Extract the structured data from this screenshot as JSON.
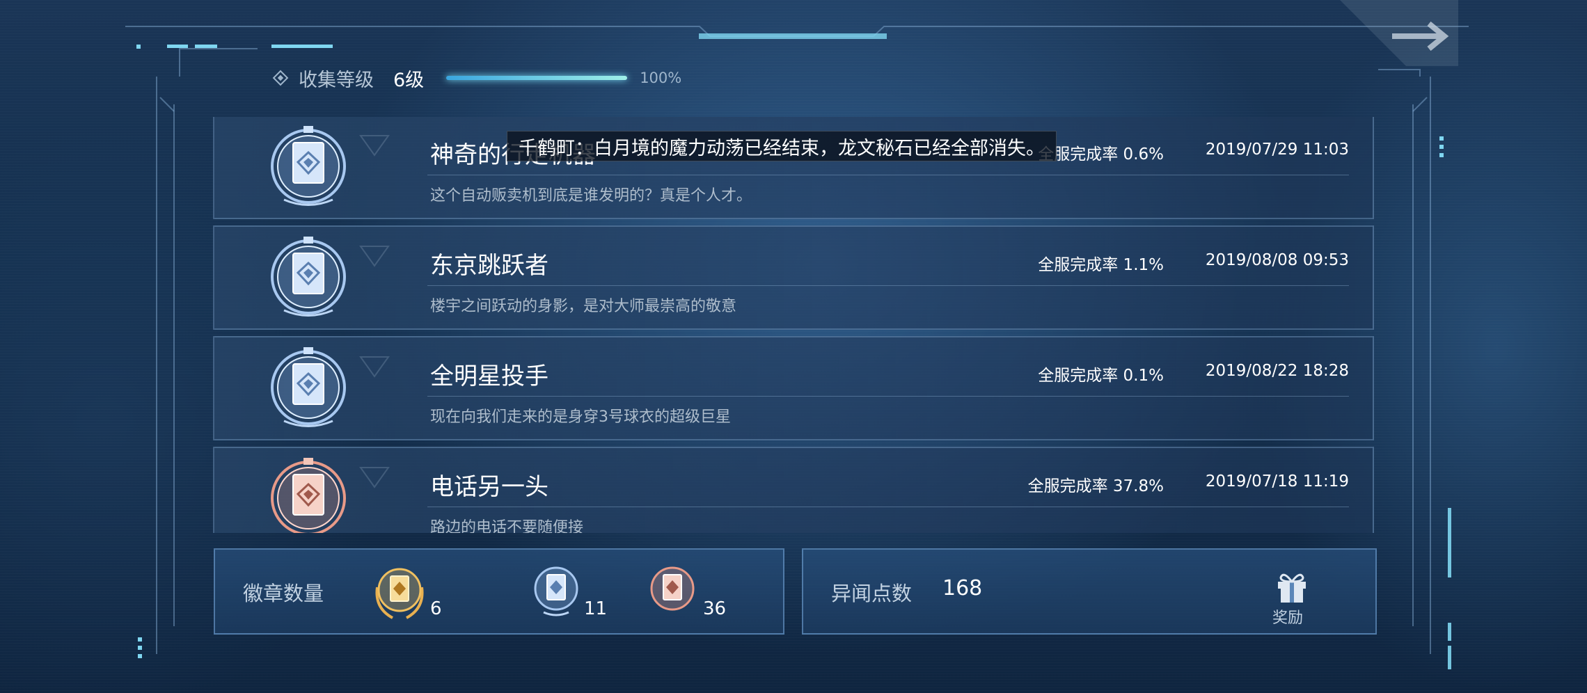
{
  "header": {
    "level_label": "收集等级",
    "level_value": "6级",
    "progress_percent": 100,
    "progress_text": "100%"
  },
  "toast": {
    "text": "千鹤町：白月境的魔力动荡已经结束，龙文秘石已经全部消失。"
  },
  "achievements": [
    {
      "name": "神奇的行走机器",
      "completion": "全服完成率 0.6%",
      "date": "2019/07/29 11:03",
      "description": "这个自动贩卖机到底是谁发明的？真是个人才。",
      "tier": "silver"
    },
    {
      "name": "东京跳跃者",
      "completion": "全服完成率 1.1%",
      "date": "2019/08/08 09:53",
      "description": "楼宇之间跃动的身影，是对大师最崇高的敬意",
      "tier": "silver"
    },
    {
      "name": "全明星投手",
      "completion": "全服完成率 0.1%",
      "date": "2019/08/22 18:28",
      "description": "现在向我们走来的是身穿3号球衣的超级巨星",
      "tier": "silver"
    },
    {
      "name": "电话另一头",
      "completion": "全服完成率 37.8%",
      "date": "2019/07/18 11:19",
      "description": "路边的电话不要随便接",
      "tier": "bronze"
    }
  ],
  "badges_panel": {
    "label": "徽章数量",
    "gold_count": "6",
    "silver_count": "11",
    "bronze_count": "36"
  },
  "points_panel": {
    "label": "异闻点数",
    "value": "168",
    "reward_label": "奖励"
  },
  "colors": {
    "accent": "#7fe6ff",
    "silver": "#b8d4f5",
    "bronze": "#f0a99a",
    "gold": "#f0c060"
  }
}
